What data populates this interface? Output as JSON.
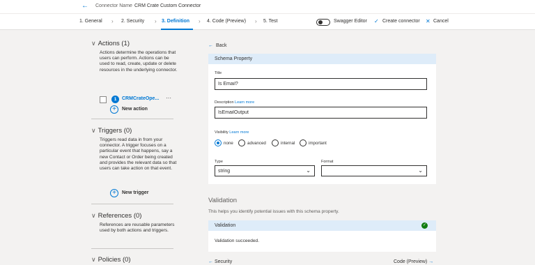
{
  "header": {
    "back_icon": "arrow-left-icon",
    "connector_label": "Connector Name",
    "connector_name": "CRM Crate Custom Connector"
  },
  "steps": [
    {
      "label": "1. General"
    },
    {
      "label": "2. Security"
    },
    {
      "label": "3. Definition"
    },
    {
      "label": "4. Code (Preview)"
    },
    {
      "label": "5. Test"
    }
  ],
  "toolbar": {
    "swagger_label": "Swagger Editor",
    "create_label": "Create connector",
    "cancel_label": "Cancel"
  },
  "left": {
    "actions": {
      "title": "Actions (1)",
      "desc": "Actions determine the operations that users can perform. Actions can be used to read, create, update or delete resources in the underlying connector.",
      "op_number": "1",
      "op_name": "CRMCrateOpe...",
      "op_more": "···",
      "add_label": "New action"
    },
    "triggers": {
      "title": "Triggers (0)",
      "desc": "Triggers read data in from your connector. A trigger focuses on a particular event that happens, say a new Contact or Order being created and provides the relevant data so that users can take action on that event.",
      "add_label": "New trigger"
    },
    "references": {
      "title": "References (0)",
      "desc": "References are reusable parameters used by both actions and triggers."
    },
    "policies": {
      "title": "Policies (0)"
    }
  },
  "schema": {
    "back_label": "Back",
    "header": "Schema Property",
    "title_label": "Title",
    "title_value": "Is Email?",
    "description_label": "Description",
    "learn_more": "Learn more",
    "description_value": "IsEmailOutput",
    "visibility_label": "Visibility",
    "visibility_options": [
      "none",
      "advanced",
      "internal",
      "important"
    ],
    "visibility_selected": "none",
    "type_label": "Type",
    "type_value": "string",
    "format_label": "Format",
    "format_value": ""
  },
  "validation": {
    "title": "Validation",
    "desc": "This helps you identify potential issues with this schema property.",
    "header": "Validation",
    "message": "Validation succeeded."
  },
  "footer": {
    "prev_label": "Security",
    "next_label": "Code (Preview)"
  },
  "colors": {
    "accent": "#0078d4",
    "success": "#107c10",
    "header_bg": "#deecf9",
    "page_bg": "#f3f2f1"
  }
}
